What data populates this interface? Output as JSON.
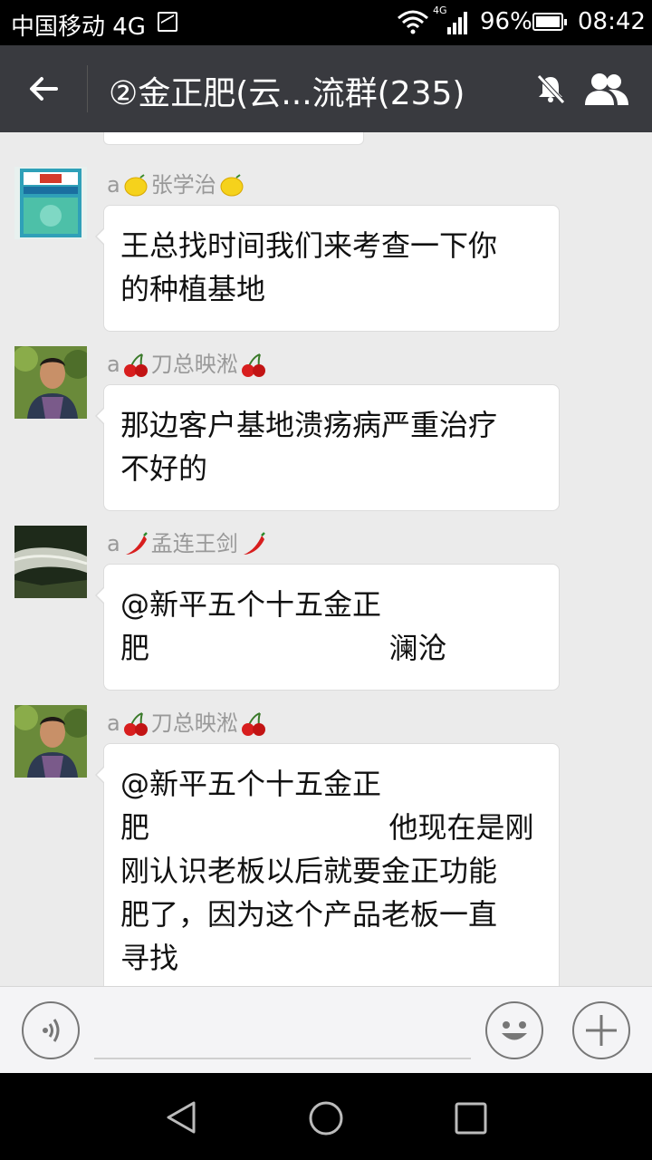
{
  "status_bar": {
    "carrier": "中国移动 4G",
    "network_label": "4G",
    "battery": "96%",
    "time": "08:42"
  },
  "title_bar": {
    "title": "②金正肥(云...流群(235)"
  },
  "messages": [
    {
      "sender_prefix": "a",
      "sender_name": "张学治",
      "emoji": "lemon",
      "lines": [
        "王总找时间我们来考查一下你",
        "的种植基地"
      ]
    },
    {
      "sender_prefix": "a",
      "sender_name": "刀总映淞",
      "emoji": "cherries",
      "lines": [
        "那边客户基地溃疡病严重治疗",
        "不好的"
      ]
    },
    {
      "sender_prefix": "a",
      "sender_name": "孟连王剑",
      "emoji": "chili-pepper",
      "lines": [
        "@新平五个十五金正",
        "肥                          澜沧"
      ]
    },
    {
      "sender_prefix": "a",
      "sender_name": "刀总映淞",
      "emoji": "cherries",
      "lines": [
        "@新平五个十五金正",
        "肥                          他现在是刚",
        "刚认识老板以后就要金正功能",
        "肥了，因为这个产品老板一直",
        "寻找"
      ]
    }
  ],
  "icons": {
    "back": "arrow-left-icon",
    "mute": "bell-off-icon",
    "members": "group-members-icon",
    "voice": "voice-input-icon",
    "emoji": "smiley-icon",
    "more": "plus-icon"
  },
  "colors": {
    "title_bar": "#393a3f",
    "chat_bg": "#ebebeb",
    "bubble": "#ffffff",
    "sender_text": "#999999"
  }
}
